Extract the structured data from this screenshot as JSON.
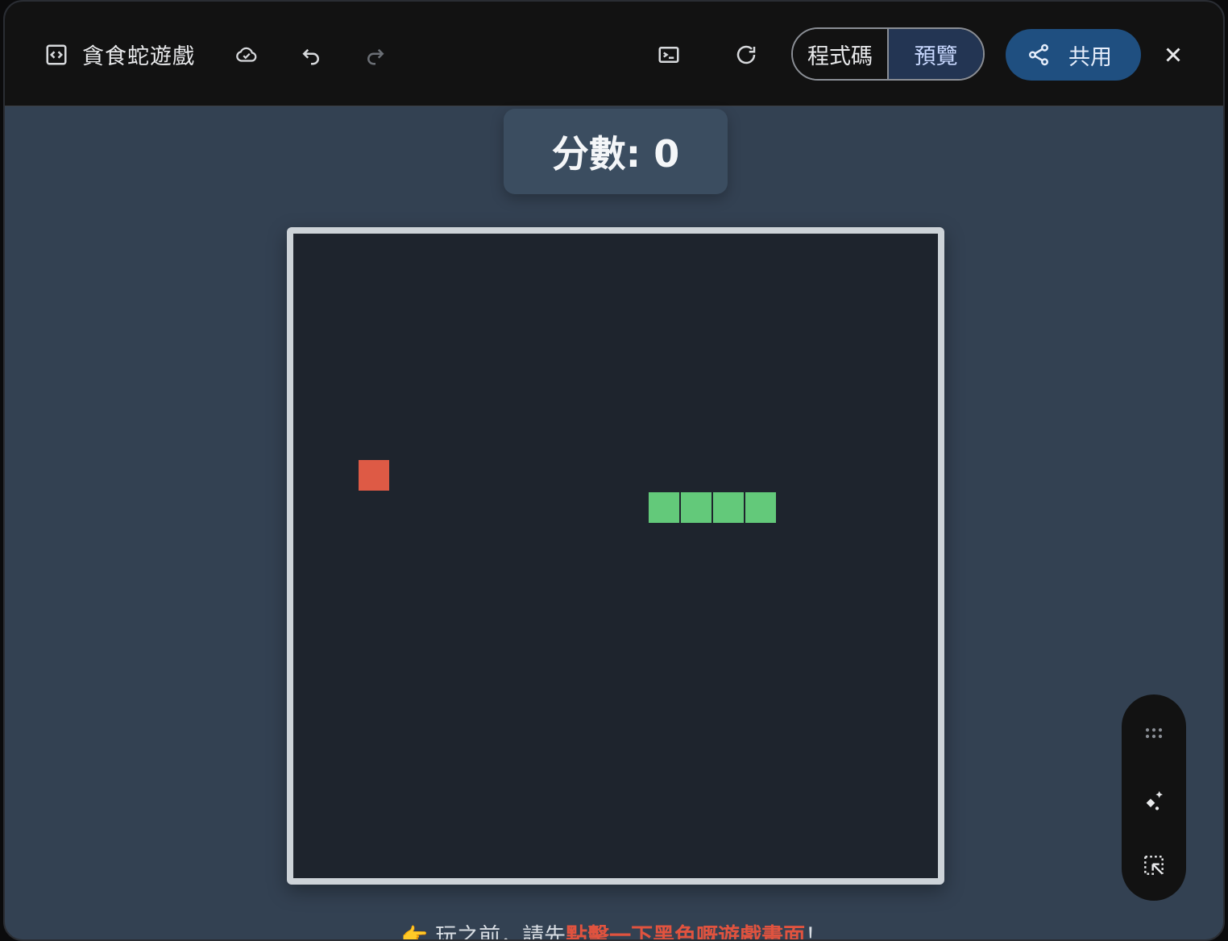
{
  "app": {
    "title": "貪食蛇遊戲",
    "view_toggle": {
      "code_label": "程式碼",
      "preview_label": "預覽",
      "selected": "預覽"
    },
    "share_label": "共用"
  },
  "game": {
    "score_text": "分數: 0",
    "hint_prefix": "👉 玩之前，請先",
    "hint_emphasis": "點擊一下黑色嘅遊戲畫面",
    "hint_suffix": "！",
    "grid": {
      "cols": 20,
      "rows": 20
    },
    "food": {
      "x": 2,
      "y": 7
    },
    "snake": [
      {
        "x": 11,
        "y": 8
      },
      {
        "x": 12,
        "y": 8
      },
      {
        "x": 13,
        "y": 8
      },
      {
        "x": 14,
        "y": 8
      }
    ],
    "colors": {
      "food": "#de5a45",
      "snake": "#63c97a",
      "board": "#1e242d"
    }
  },
  "icons": {
    "code_window": "code-window-icon",
    "cloud": "cloud-save-icon",
    "undo": "undo-icon",
    "redo": "redo-icon",
    "console": "console-icon",
    "refresh": "refresh-icon",
    "share": "share-icon",
    "close": "close-icon",
    "drag": "drag-handle-icon",
    "magic": "magic-edit-icon",
    "select": "select-element-icon"
  }
}
